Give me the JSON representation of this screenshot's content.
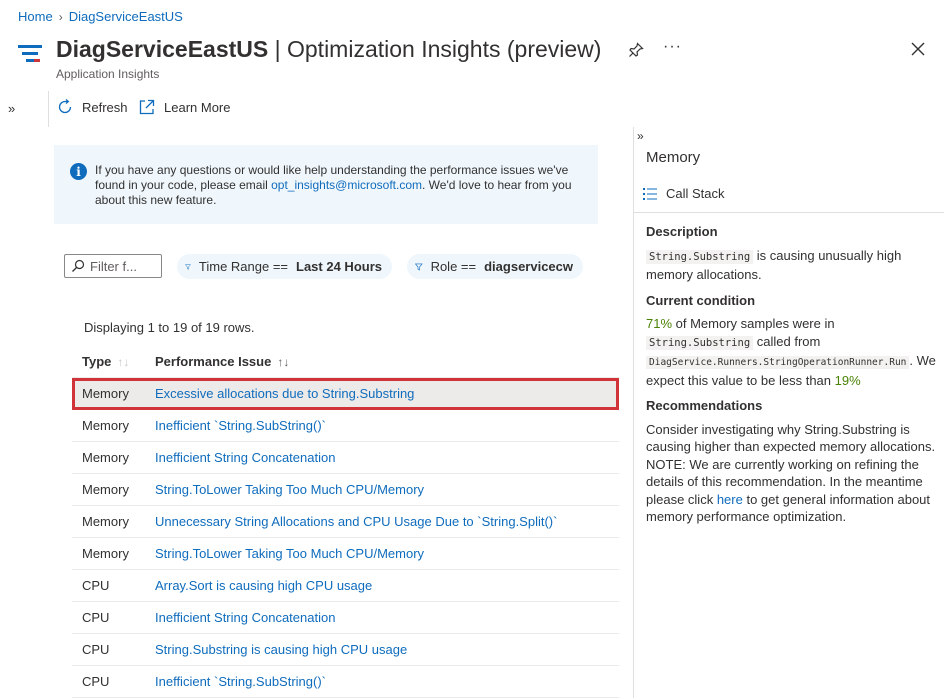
{
  "breadcrumb": {
    "home": "Home",
    "resource": "DiagServiceEastUS"
  },
  "header": {
    "resource_name": "DiagServiceEastUS",
    "separator": "|",
    "page_name": "Optimization Insights (preview)",
    "subtitle": "Application Insights",
    "more_label": "···"
  },
  "toolbar": {
    "refresh_label": "Refresh",
    "learn_more_label": "Learn More",
    "expand_label": "»"
  },
  "info": {
    "text_before": "If you have any questions or would like help understanding the performance issues we've found in your code, please email ",
    "email": "opt_insights@microsoft.com",
    "text_after": ". We'd love to hear from you about this new feature."
  },
  "filters": {
    "search_placeholder": "Filter f...",
    "time_range_label": "Time Range ==",
    "time_range_value": "Last 24 Hours",
    "role_label": "Role ==",
    "role_value": "diagservicecw"
  },
  "table": {
    "row_count_text": "Displaying 1 to 19 of 19 rows.",
    "headers": {
      "type": "Type",
      "issue": "Performance Issue"
    },
    "rows": [
      {
        "type": "Memory",
        "issue": "Excessive allocations due to String.Substring"
      },
      {
        "type": "Memory",
        "issue": "Inefficient `String.SubString()`"
      },
      {
        "type": "Memory",
        "issue": "Inefficient String Concatenation"
      },
      {
        "type": "Memory",
        "issue": "String.ToLower Taking Too Much CPU/Memory"
      },
      {
        "type": "Memory",
        "issue": "Unnecessary String Allocations and CPU Usage Due to `String.Split()`"
      },
      {
        "type": "Memory",
        "issue": "String.ToLower Taking Too Much CPU/Memory"
      },
      {
        "type": "CPU",
        "issue": "Array.Sort is causing high CPU usage"
      },
      {
        "type": "CPU",
        "issue": "Inefficient String Concatenation"
      },
      {
        "type": "CPU",
        "issue": "String.Substring is causing high CPU usage"
      },
      {
        "type": "CPU",
        "issue": "Inefficient `String.SubString()`"
      }
    ]
  },
  "detail": {
    "collapse_label": "»",
    "title": "Memory",
    "call_stack_label": "Call Stack",
    "description_heading": "Description",
    "description_code": "String.Substring",
    "description_text": " is causing unusually high memory allocations.",
    "condition_heading": "Current condition",
    "condition_percent": "71%",
    "condition_text1": " of Memory samples were in ",
    "condition_code1": "String.Substring",
    "condition_text2": " called from ",
    "condition_code2": "DiagService.Runners.StringOperationRunner.Run",
    "condition_text3": ". We expect this value to be less than ",
    "condition_threshold": "19%",
    "recommendations_heading": "Recommendations",
    "recommendations_text1": "Consider investigating why String.Substring is causing higher than expected memory allocations. NOTE: We are currently working on refining the details of this recommendation. In the meantime please click ",
    "recommendations_link": "here",
    "recommendations_text2": " to get general information about memory performance optimization."
  },
  "colors": {
    "accent": "#0f6cbd",
    "selection_outline": "#d13438",
    "green": "#498205"
  }
}
